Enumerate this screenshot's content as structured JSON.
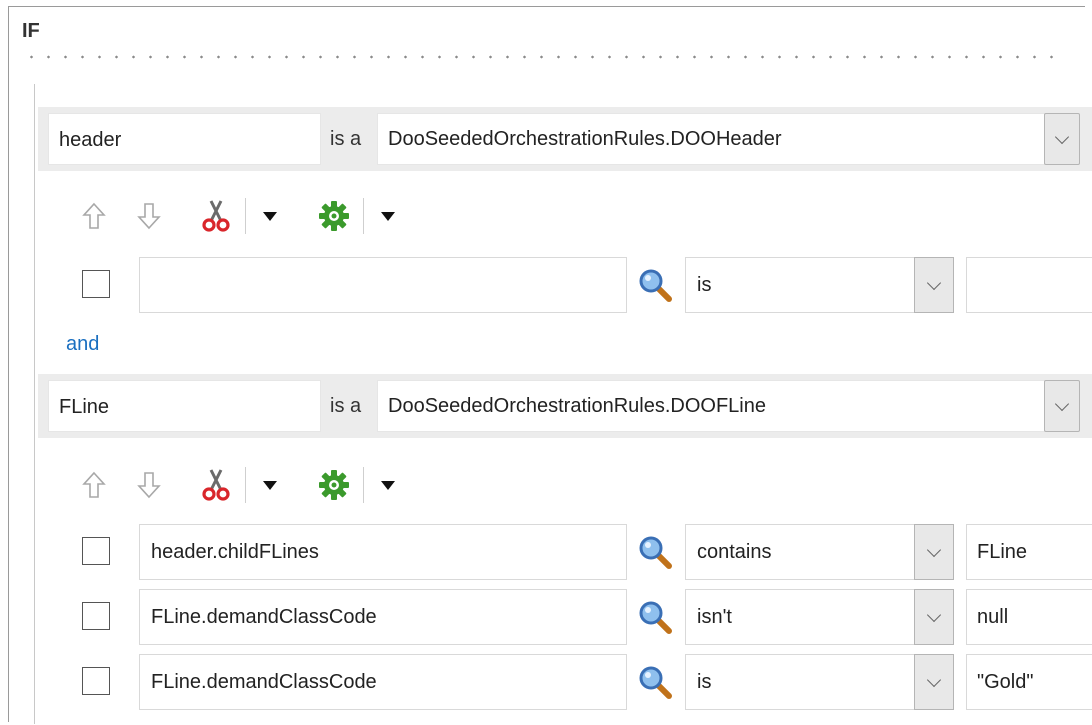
{
  "if_label": "IF",
  "and_label": "and",
  "is_a_label": "is a",
  "facts": [
    {
      "alias": "header",
      "type": "DooSeededOrchestrationRules.DOOHeader",
      "conditions": [
        {
          "left": "",
          "operator": "is",
          "right": ""
        }
      ]
    },
    {
      "alias": "FLine",
      "type": "DooSeededOrchestrationRules.DOOFLine",
      "conditions": [
        {
          "left": "header.childFLines",
          "operator": "contains",
          "right": "FLine"
        },
        {
          "left": "FLine.demandClassCode",
          "operator": "isn't",
          "right": "null"
        },
        {
          "left": "FLine.demandClassCode",
          "operator": "is",
          "right": "\"Gold\""
        }
      ]
    }
  ],
  "toolbar_icons": [
    "move-up-icon",
    "move-down-icon",
    "cut-icon",
    "dropdown-arrow-icon",
    "gear-icon",
    "dropdown-arrow-icon"
  ],
  "colors": {
    "link": "#1a6fc0",
    "band": "#ececec",
    "cut_red": "#d9262b",
    "gear_green": "#3b9a2c"
  }
}
